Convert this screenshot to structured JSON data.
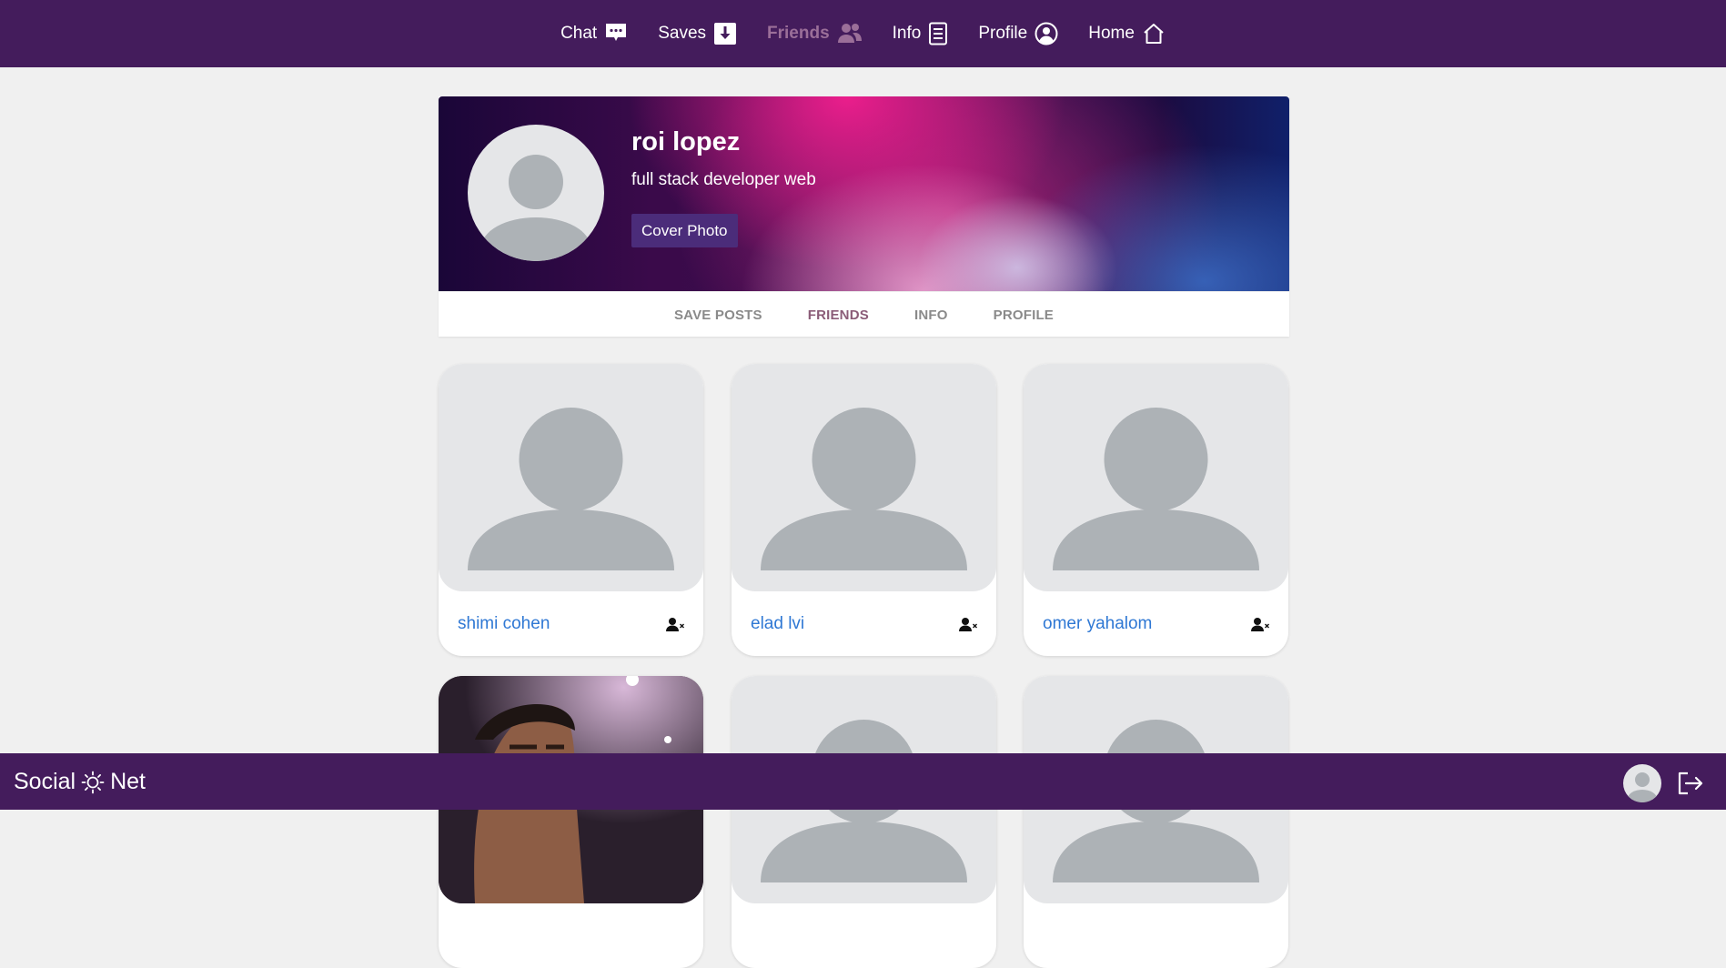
{
  "nav": {
    "items": [
      {
        "label": "Chat",
        "icon": "chat-icon"
      },
      {
        "label": "Saves",
        "icon": "save-icon"
      },
      {
        "label": "Friends",
        "icon": "friends-icon",
        "active": true
      },
      {
        "label": "Info",
        "icon": "document-icon"
      },
      {
        "label": "Profile",
        "icon": "user-circle-icon"
      },
      {
        "label": "Home",
        "icon": "home-icon"
      }
    ]
  },
  "profile": {
    "name": "roi lopez",
    "description": "full stack developer web",
    "cover_button": "Cover Photo"
  },
  "tabs": [
    {
      "label": "SAVE POSTS"
    },
    {
      "label": "FRIENDS",
      "active": true
    },
    {
      "label": "INFO"
    },
    {
      "label": "PROFILE"
    }
  ],
  "friends": [
    {
      "name": "shimi cohen",
      "photo": "default-avatar"
    },
    {
      "name": "elad lvi",
      "photo": "default-avatar"
    },
    {
      "name": "omer yahalom",
      "photo": "default-avatar"
    },
    {
      "name": "",
      "photo": "user-photo"
    },
    {
      "name": "",
      "photo": "default-avatar"
    },
    {
      "name": "",
      "photo": "default-avatar"
    }
  ],
  "footer": {
    "brand_left": "Social",
    "brand_right": "Net"
  },
  "colors": {
    "bar": "#441c5c",
    "active_nav": "#9b6f99",
    "link": "#2f78d4",
    "cover_button": "#4b2c7a"
  }
}
